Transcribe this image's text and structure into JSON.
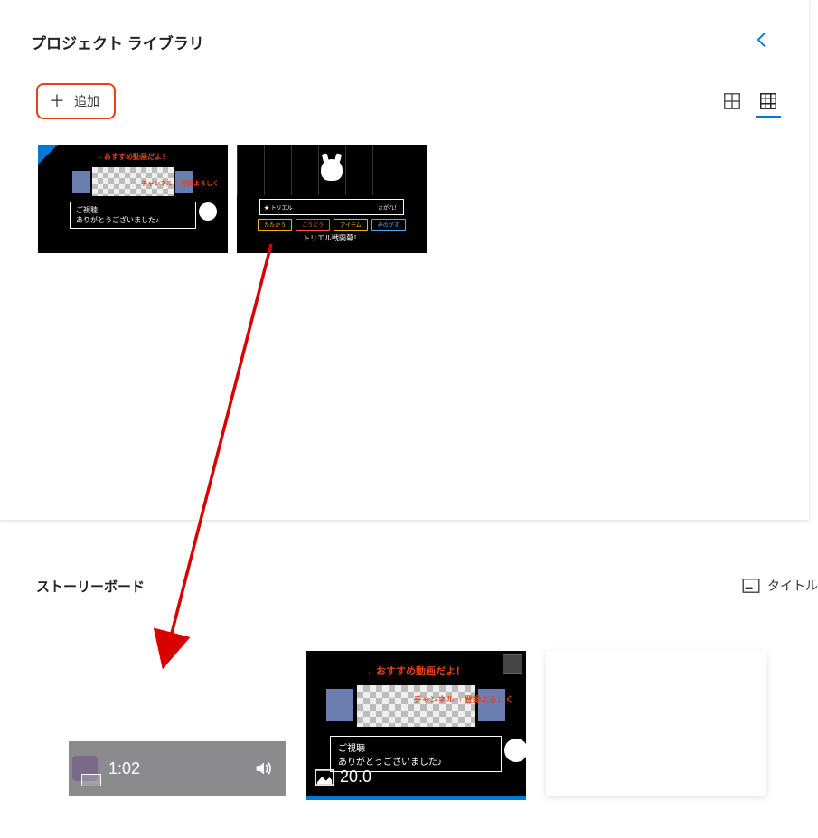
{
  "library": {
    "title": "プロジェクト ライブラリ",
    "add_label": "追加",
    "items": [
      {
        "red_top": "←おすすめ動画だよ！",
        "side_red": "チャンネル↑↑\n登録よろしく",
        "textbox_line1": "ご視聴",
        "textbox_line2": "ありがとうございました♪"
      },
      {
        "ui_left": "★ トリエル",
        "ui_right": "さがれ！",
        "btn1": "たたかう",
        "btn2": "こうどう",
        "btn3": "アイテム",
        "btn4": "みのがす",
        "caption": "トリエル戦開幕！"
      }
    ]
  },
  "storyboard": {
    "title": "ストーリーボード",
    "title_card_label": "タイトル",
    "placeholder_duration": "1:02",
    "selected_clip": {
      "red_top": "←おすすめ動画だよ！",
      "side_red": "チャンネル↑↑\n登録よろしく",
      "textbox_line1": "ご視聴",
      "textbox_line2": "ありがとうございました♪",
      "duration": "20.0"
    }
  }
}
